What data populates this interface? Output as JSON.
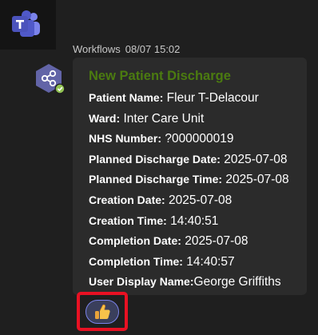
{
  "header": {
    "sender": "Workflows",
    "timestamp": "08/07 15:02"
  },
  "card": {
    "title": "New Patient Discharge",
    "title_color": "#4b7b10",
    "fields": [
      {
        "label": "Patient Name:",
        "value": " Fleur T-Delacour"
      },
      {
        "label": "Ward:",
        "value": " Inter Care Unit"
      },
      {
        "label": "NHS Number:",
        "value": " ?000000019"
      },
      {
        "label": "Planned Discharge Date:",
        "value": " 2025-07-08"
      },
      {
        "label": "Planned Discharge Time:",
        "value": " 2025-07-08"
      },
      {
        "label": "Creation Date:",
        "value": " 2025-07-08"
      },
      {
        "label": "Creation Time:",
        "value": " 14:40:51"
      },
      {
        "label": "Completion Date:",
        "value": " 2025-07-08"
      },
      {
        "label": "Completion Time:",
        "value": " 14:40:57"
      },
      {
        "label": "User Display Name:",
        "value": "George Griffiths"
      }
    ]
  },
  "icons": {
    "app_logo": "teams-logo-icon",
    "bot_avatar": "workflow-hexagon-icon",
    "verified_badge": "checkmark-badge-icon",
    "reaction": "thumbs-up-icon"
  },
  "colors": {
    "background": "#1f1f1f",
    "card": "#2b2b2b",
    "accent": "#6264a7",
    "highlight": "#e81123"
  }
}
